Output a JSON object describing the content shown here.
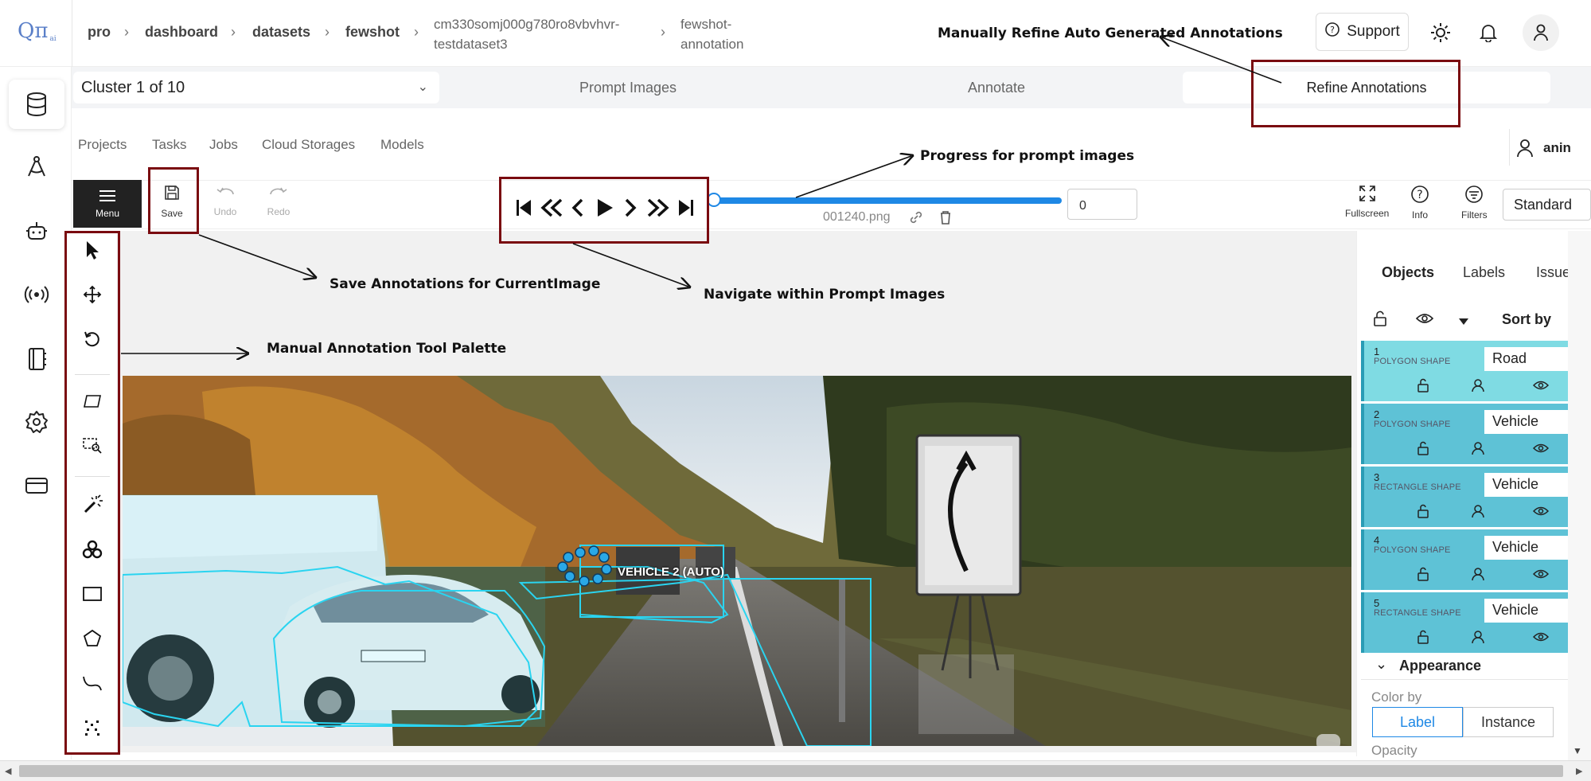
{
  "header": {
    "logo": "Qπ",
    "logo_sub": "ai",
    "breadcrumb": [
      "pro",
      "dashboard",
      "datasets",
      "fewshot"
    ],
    "breadcrumb_id_line1": "cm330somj000g780ro8vbvhvr-",
    "breadcrumb_id_line2": "testdataset3",
    "breadcrumb_last_line1": "fewshot-",
    "breadcrumb_last_line2": "annotation",
    "support_label": "Support"
  },
  "workflow": {
    "cluster_label": "Cluster 1 of 10",
    "tabs": [
      "Prompt Images",
      "Annotate",
      "Refine Annotations"
    ]
  },
  "menubar": {
    "items": [
      "Projects",
      "Tasks",
      "Jobs",
      "Cloud Storages",
      "Models"
    ],
    "user": "anin"
  },
  "toolbar": {
    "menu_label": "Menu",
    "save_label": "Save",
    "undo_label": "Undo",
    "redo_label": "Redo",
    "frame_value": "0",
    "filename": "001240.png",
    "progress": 0.0,
    "fullscreen_label": "Fullscreen",
    "info_label": "Info",
    "filters_label": "Filters",
    "workspace": "Standard"
  },
  "canvas": {
    "object_label": "VEHICLE 2 (AUTO)"
  },
  "side_panel": {
    "tabs": [
      "Objects",
      "Labels",
      "Issue"
    ],
    "sort_label": "Sort by",
    "objects": [
      {
        "id": "1",
        "shape": "POLYGON SHAPE",
        "label": "Road",
        "color": "#7fdbe3"
      },
      {
        "id": "2",
        "shape": "POLYGON SHAPE",
        "label": "Vehicle",
        "color": "#5ec2d6"
      },
      {
        "id": "3",
        "shape": "RECTANGLE SHAPE",
        "label": "Vehicle",
        "color": "#5ec2d6"
      },
      {
        "id": "4",
        "shape": "POLYGON SHAPE",
        "label": "Vehicle",
        "color": "#5ec2d6"
      },
      {
        "id": "5",
        "shape": "RECTANGLE SHAPE",
        "label": "Vehicle",
        "color": "#5ec2d6"
      }
    ],
    "appearance_label": "Appearance",
    "color_by_label": "Color by",
    "color_by_options": [
      "Label",
      "Instance"
    ],
    "color_by_selected": "Label",
    "opacity_label": "Opacity"
  },
  "annotations": {
    "refine": "Manually Refine Auto Generated Annotations",
    "progress": "Progress for prompt images",
    "save": "Save Annotations for CurrentImage",
    "navigate": "Navigate within Prompt Images",
    "palette": "Manual Annotation Tool Palette"
  },
  "colors": {
    "accent": "#1e88e5",
    "annotation_box": "#7a0b10",
    "object_row": "#5ec2d6",
    "object_row_selected": "#7fdbe3",
    "mask_outline": "#2ad4f0"
  }
}
